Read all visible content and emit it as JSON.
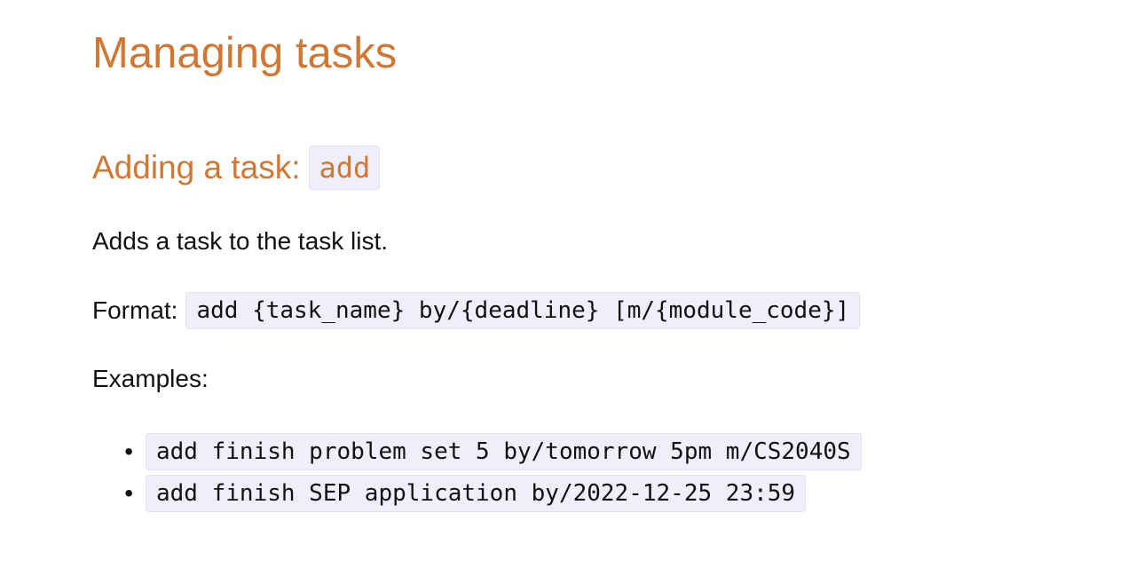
{
  "page": {
    "title": "Managing tasks"
  },
  "section": {
    "title": "Adding a task:",
    "command": "add",
    "description": "Adds a task to the task list.",
    "format_label": "Format:",
    "format_code": "add {task_name} by/{deadline} [m/{module_code}]",
    "examples_label": "Examples:",
    "examples": [
      "add finish problem set 5 by/tomorrow 5pm m/CS2040S",
      "add finish SEP application by/2022-12-25 23:59"
    ]
  }
}
